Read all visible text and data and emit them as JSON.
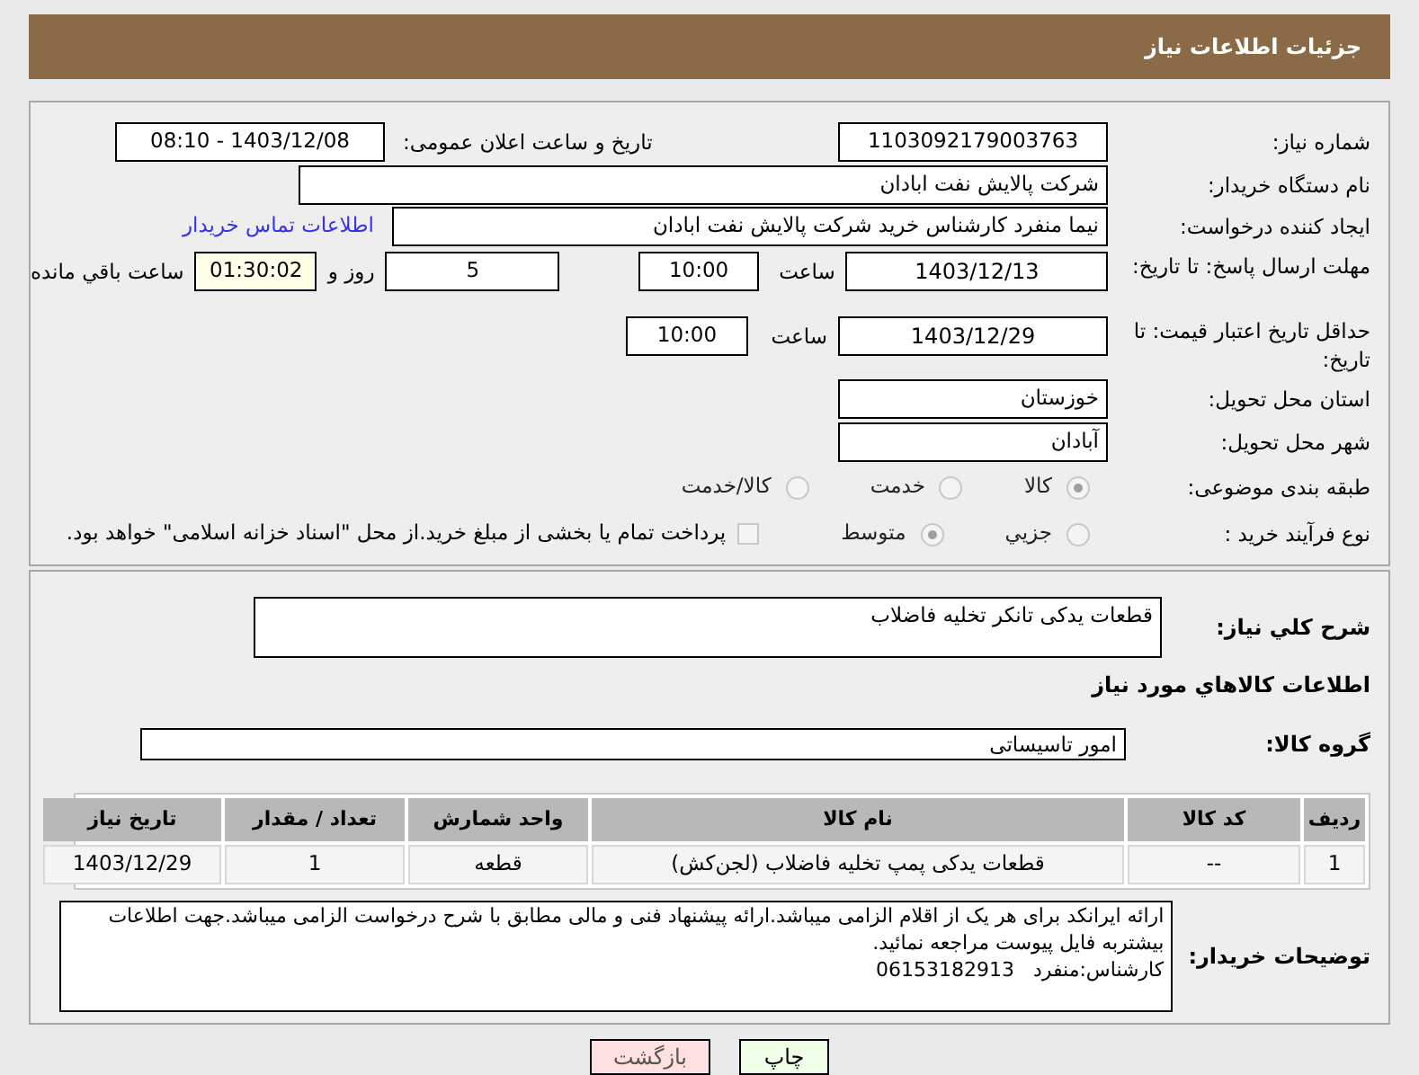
{
  "header": {
    "title": "جزئیات اطلاعات نیاز"
  },
  "need_number": {
    "label": "شماره نیاز:",
    "value": "1103092179003763"
  },
  "announce": {
    "label": "تاریخ و ساعت اعلان عمومی:",
    "value": "1403/12/08 - 08:10"
  },
  "buyer_org": {
    "label": "نام دستگاه خریدار:",
    "value": "شرکت پالایش نفت ابادان"
  },
  "creator": {
    "label": "ایجاد کننده درخواست:",
    "value": "نیما منفرد کارشناس خرید شرکت پالایش نفت ابادان",
    "link": "اطلاعات تماس خریدار"
  },
  "deadline": {
    "label": "مهلت ارسال پاسخ: تا تاریخ:",
    "date": "1403/12/13",
    "time_label": "ساعت",
    "time": "10:00",
    "days": "5",
    "days_label": "روز و",
    "remaining": "01:30:02",
    "remaining_label": "ساعت باقي مانده"
  },
  "validity": {
    "label": "حداقل تاریخ اعتبار قیمت: تا تاریخ:",
    "date": "1403/12/29",
    "time_label": "ساعت",
    "time": "10:00"
  },
  "province": {
    "label": "استان محل تحویل:",
    "value": "خوزستان"
  },
  "city": {
    "label": "شهر محل تحویل:",
    "value": "آبادان"
  },
  "category": {
    "label": "طبقه بندی موضوعی:",
    "options": [
      {
        "label": "کالا",
        "selected": true
      },
      {
        "label": "خدمت",
        "selected": false
      },
      {
        "label": "کالا/خدمت",
        "selected": false
      }
    ]
  },
  "process": {
    "label": "نوع فرآیند خرید :",
    "options": [
      {
        "label": "جزيي",
        "selected": false
      },
      {
        "label": "متوسط",
        "selected": true
      }
    ],
    "payment": {
      "label": "پرداخت تمام یا بخشی از مبلغ خرید.از محل \"اسناد خزانه اسلامی\" خواهد بود.",
      "checked": false
    }
  },
  "description": {
    "label": "شرح کلي نياز:",
    "value": "قطعات یدکی تانکر تخلیه فاضلاب"
  },
  "goods_title": "اطلاعات کالاهاي مورد نياز",
  "group": {
    "label": "گروه کالا:",
    "value": "امور تاسیساتی"
  },
  "table": {
    "columns": [
      "رديف",
      "کد کالا",
      "نام کالا",
      "واحد شمارش",
      "تعداد / مقدار",
      "تاریخ نیاز"
    ],
    "rows": [
      [
        "1",
        "--",
        "قطعات یدکی پمپ تخلیه فاضلاب (لجن‌کش)",
        "قطعه",
        "1",
        "1403/12/29"
      ]
    ]
  },
  "buyer_notes": {
    "label": "توضیحات خریدار:",
    "value": "ارائه ایرانکد برای هر یک از اقلام الزامی میباشد.ارائه پیشنهاد فنی و مالی مطابق با شرح درخواست الزامی میباشد.جهت اطلاعات بیشتربه فایل پیوست مراجعه نمائید.\nکارشناس:منفرد   06153182913"
  },
  "buttons": [
    {
      "label": "چاپ",
      "kind": "print"
    },
    {
      "label": "بازگشت",
      "kind": "back"
    }
  ]
}
